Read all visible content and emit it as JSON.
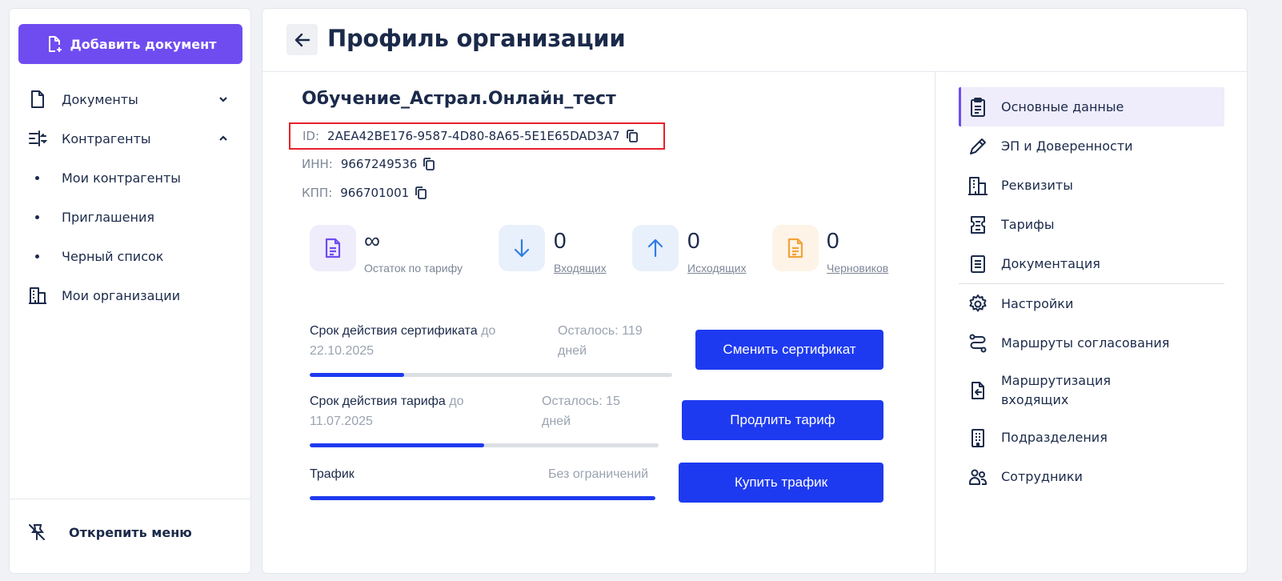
{
  "sidebar": {
    "add_button": "Добавить документ",
    "items": [
      {
        "label": "Документы",
        "icon": "document-icon",
        "chevron": "down"
      },
      {
        "label": "Контрагенты",
        "icon": "contractors-icon",
        "chevron": "up"
      }
    ],
    "subitems": [
      {
        "label": "Мои контрагенты"
      },
      {
        "label": "Приглашения"
      },
      {
        "label": "Черный список"
      }
    ],
    "my_orgs": "Мои организации",
    "unpin": "Открепить меню"
  },
  "header": {
    "title": "Профиль организации"
  },
  "org": {
    "name": "Обучение_Астрал.Онлайн_тест",
    "id_label": "ID:",
    "id_value": "2AEA42BE176-9587-4D80-8A65-5E1E65DAD3A7",
    "inn_label": "ИНН:",
    "inn_value": "9667249536",
    "kpp_label": "КПП:",
    "kpp_value": "966701001"
  },
  "stats": [
    {
      "value": "∞",
      "caption": "Остаток по тарифу",
      "icon": "document-icon",
      "color": "#6f4cf0",
      "bg": "#efecfb",
      "link": false
    },
    {
      "value": "0",
      "caption": "Входящих",
      "icon": "arrow-down-icon",
      "color": "#2f7de1",
      "bg": "#e8f0fb",
      "link": true
    },
    {
      "value": "0",
      "caption": "Исходящих",
      "icon": "arrow-up-icon",
      "color": "#2f7de1",
      "bg": "#e8f0fb",
      "link": true
    },
    {
      "value": "0",
      "caption": "Черновиков",
      "icon": "draft-icon",
      "color": "#f2a33a",
      "bg": "#fdf3e6",
      "link": true
    }
  ],
  "progress": {
    "cert": {
      "label": "Срок действия сертификата",
      "date_prefix": "до",
      "date": "22.10.2025",
      "remain_line1": "Осталось: 119",
      "remain_line2": "дней",
      "fill": 0.26,
      "button": "Сменить сертификат"
    },
    "tariff": {
      "label": "Срок действия тарифа",
      "date_prefix": "до",
      "date": "11.07.2025",
      "remain_line1": "Осталось: 15",
      "remain_line2": "дней",
      "fill": 0.5,
      "button": "Продлить тариф"
    },
    "traffic": {
      "label": "Трафик",
      "remain": "Без ограничений",
      "fill": 1.0,
      "button": "Купить трафик"
    }
  },
  "right_menu": [
    {
      "label": "Основные данные",
      "icon": "clipboard-icon",
      "active": true
    },
    {
      "label": "ЭП и Доверенности",
      "icon": "pen-icon",
      "active": false
    },
    {
      "label": "Реквизиты",
      "icon": "building-icon",
      "active": false
    },
    {
      "label": "Тарифы",
      "icon": "tariff-icon",
      "active": false
    },
    {
      "label": "Документация",
      "icon": "documentation-icon",
      "active": false
    },
    {
      "label": "Настройки",
      "icon": "gear-icon",
      "active": false
    },
    {
      "label": "Маршруты согласования",
      "icon": "route-icon",
      "active": false
    },
    {
      "label": "Маршрутизация входящих",
      "icon": "inbox-routing-icon",
      "active": false
    },
    {
      "label": "Подразделения",
      "icon": "departments-icon",
      "active": false
    },
    {
      "label": "Сотрудники",
      "icon": "employees-icon",
      "active": false
    }
  ]
}
